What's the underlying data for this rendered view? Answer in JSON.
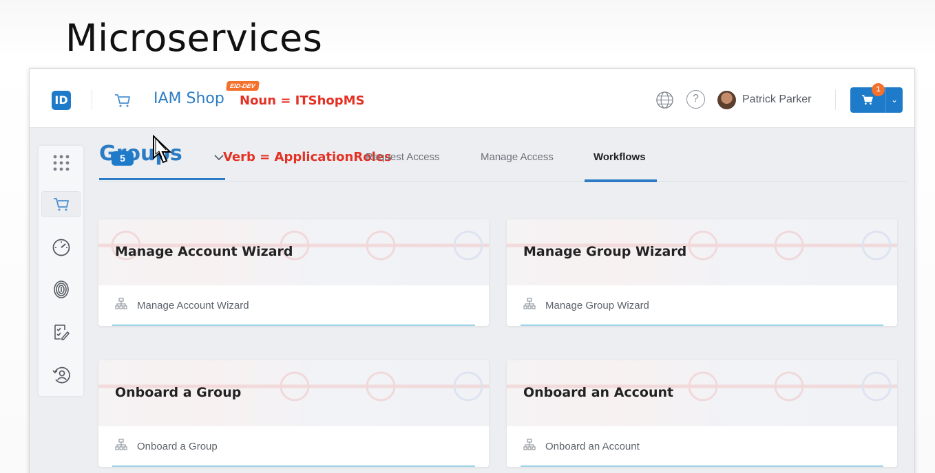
{
  "slide": {
    "title": "Microservices"
  },
  "header": {
    "logo": "ID",
    "shop_title": "IAM Shop",
    "env_badge": "EID-DEV",
    "noun_annotation": "Noun = ITShopMS",
    "user_name": "Patrick Parker",
    "cart_count": "1",
    "icons": [
      "cart-icon",
      "globe-icon",
      "help-icon",
      "avatar",
      "cart-icon",
      "chevron-down-icon"
    ]
  },
  "sidebar": {
    "items": [
      {
        "icon": "apps-grid-icon"
      },
      {
        "icon": "cart-icon",
        "active": true
      },
      {
        "icon": "speedometer-icon"
      },
      {
        "icon": "fingerprint-icon"
      },
      {
        "icon": "checklist-edit-icon"
      },
      {
        "icon": "user-history-icon"
      }
    ]
  },
  "tabs": {
    "groups_label": "Groups",
    "groups_count": "5",
    "verb_annotation": "Verb = ApplicationRoles",
    "items": [
      {
        "label": "Request Access"
      },
      {
        "label": "Manage Access"
      },
      {
        "label": "Workflows",
        "active": true
      }
    ]
  },
  "cards": [
    {
      "title": "Manage Account Wizard",
      "subtitle": "Manage Account Wizard"
    },
    {
      "title": "Manage Group Wizard",
      "subtitle": "Manage Group Wizard"
    },
    {
      "title": "Onboard a Group",
      "subtitle": "Onboard a Group"
    },
    {
      "title": "Onboard an Account",
      "subtitle": "Onboard an Account"
    }
  ],
  "colors": {
    "accent": "#1e7bc9",
    "annotation": "#e53024",
    "badge": "#f4702b"
  }
}
